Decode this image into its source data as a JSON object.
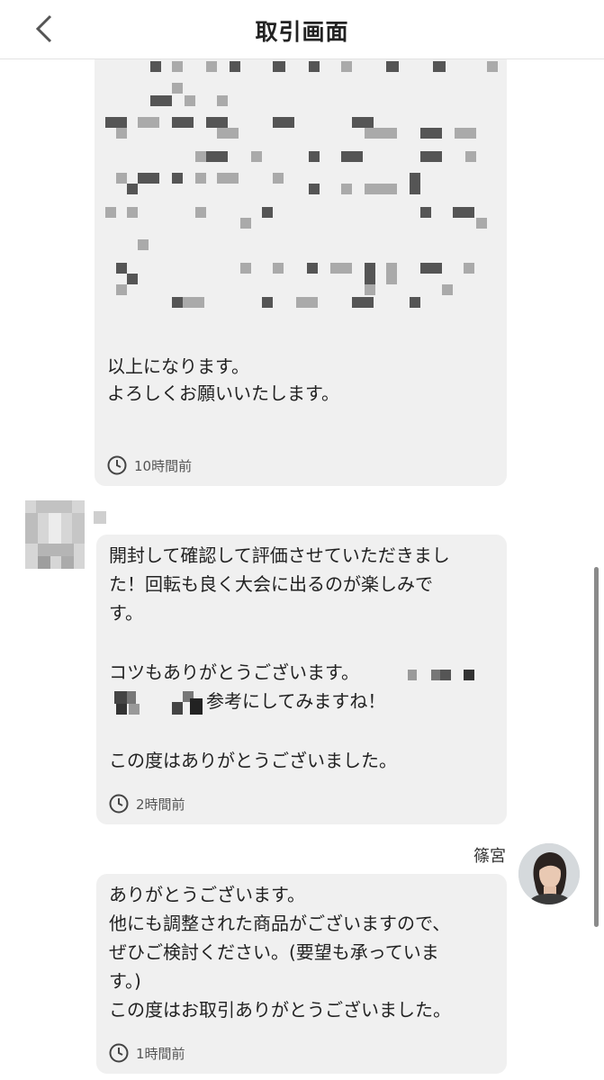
{
  "header": {
    "title": "取引画面",
    "back_icon": "chevron-left-icon"
  },
  "messages": [
    {
      "text": "以上になります。\nよろしくお願いいたします。",
      "time": "10時間前"
    },
    {
      "text": "開封して確認して評価させていただきました！回転も良く大会に出るのが楽しみです。\n\nコツもありがとうございます。\n参考にしてみますね！\n\nこの度はありがとうございました。",
      "line1": "開封して確認して評価させていただきまし",
      "line2": "た！回転も良く大会に出るのが楽しみで",
      "line3": "す。",
      "line4": "コツもありがとうございます。",
      "line5": "参考にしてみますね！",
      "line6": "この度はありがとうございました。",
      "time": "2時間前"
    },
    {
      "sender": "篠宮",
      "line1": "ありがとうございます。",
      "line2": "他にも調整された商品がございますので、",
      "line3": "ぜひご検討ください。(要望も承っていま",
      "line4": "す。)",
      "line5": "この度はお取引ありがとうございました。",
      "time": "1時間前"
    }
  ],
  "colors": {
    "bubble": "#f0f0f0",
    "header_bg": "#ffffff",
    "text": "#222222"
  }
}
